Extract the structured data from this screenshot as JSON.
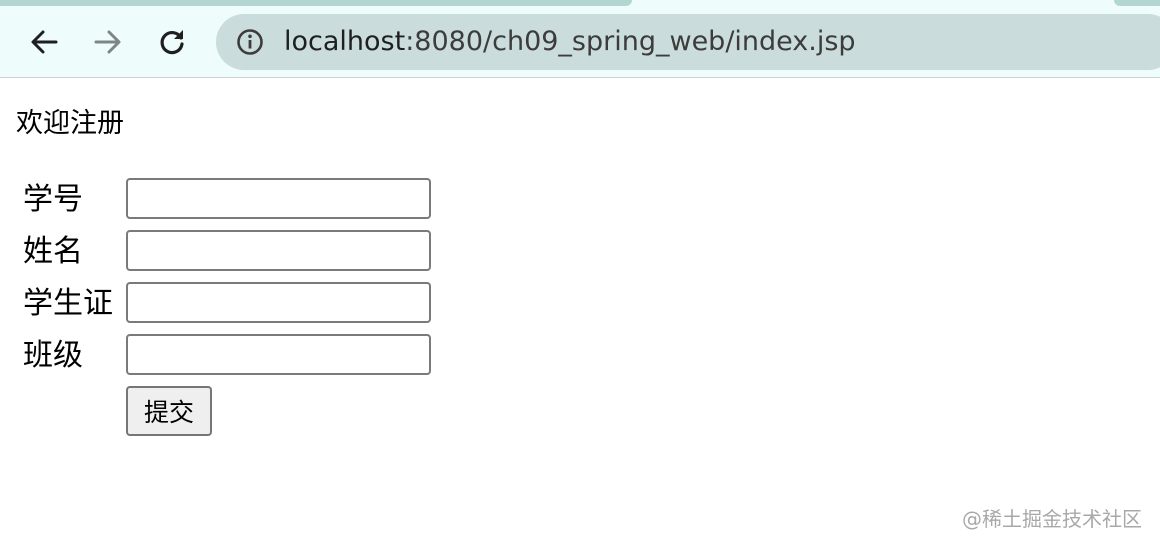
{
  "browser": {
    "url_host": "localhost",
    "url_rest": ":8080/ch09_spring_web/index.jsp",
    "icons": {
      "back": "back-arrow-icon",
      "forward": "forward-arrow-icon",
      "reload": "reload-icon",
      "info": "info-icon"
    }
  },
  "page": {
    "heading": "欢迎注册",
    "fields": [
      {
        "label": "学号",
        "value": ""
      },
      {
        "label": "姓名",
        "value": ""
      },
      {
        "label": "学生证",
        "value": ""
      },
      {
        "label": "班级",
        "value": ""
      }
    ],
    "submit_label": "提交"
  },
  "watermark": "@稀土掘金技术社区",
  "colors": {
    "toolbar_bg": "#eefdfb",
    "omnibox_bg": "#cbdcdc",
    "tab_accent": "#b4d6d3"
  }
}
